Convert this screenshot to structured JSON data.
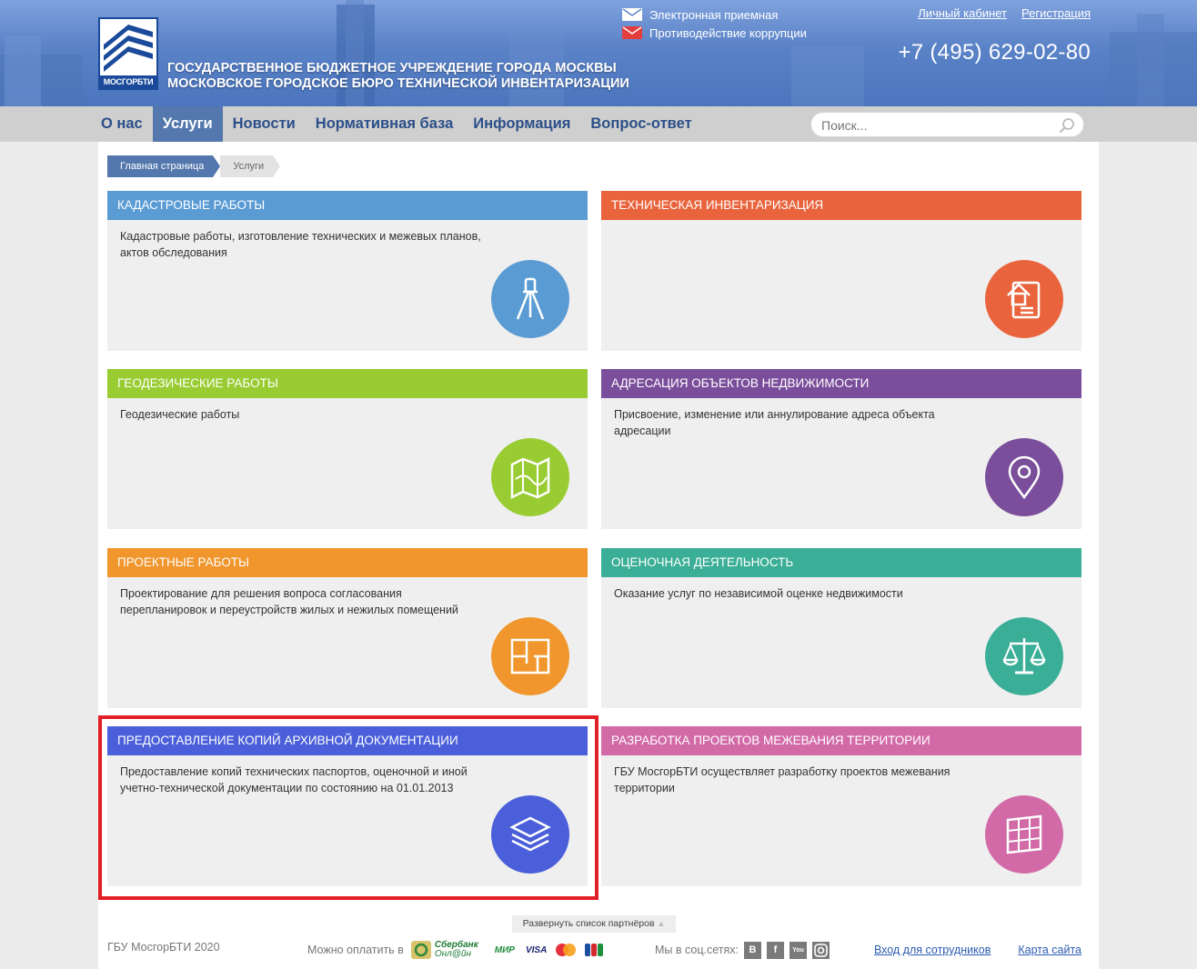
{
  "header": {
    "logo_text": "МОСГОРБТИ",
    "org_line1": "ГОСУДАРСТВЕННОЕ БЮДЖЕТНОЕ УЧРЕЖДЕНИЕ ГОРОДА МОСКВЫ",
    "org_line2": "МОСКОВСКОЕ ГОРОДСКОЕ БЮРО ТЕХНИЧЕСКОЙ ИНВЕНТАРИЗАЦИИ",
    "reception_link": "Электронная приемная",
    "anticorruption_link": "Противодействие коррупции",
    "account_link": "Личный кабинет",
    "register_link": "Регистрация",
    "phone": "+7 (495) 629-02-80"
  },
  "nav": {
    "items": [
      {
        "label": "О нас"
      },
      {
        "label": "Услуги",
        "active": true
      },
      {
        "label": "Новости"
      },
      {
        "label": "Нормативная база"
      },
      {
        "label": "Информация"
      },
      {
        "label": "Вопрос-ответ"
      }
    ],
    "search_placeholder": "Поиск..."
  },
  "breadcrumbs": {
    "home": "Главная страница",
    "current": "Услуги"
  },
  "cards": [
    {
      "title": "КАДАСТРОВЫЕ РАБОТЫ",
      "desc": "Кадастровые работы, изготовление технических и межевых планов, актов обследования",
      "color": "#5a9bd4",
      "icon": "tripod-icon"
    },
    {
      "title": "ТЕХНИЧЕСКАЯ ИНВЕНТАРИЗАЦИЯ",
      "desc": "",
      "color": "#e9643c",
      "icon": "house-document-icon"
    },
    {
      "title": "ГЕОДЕЗИЧЕСКИЕ РАБОТЫ",
      "desc": "Геодезические работы",
      "color": "#99cc33",
      "icon": "map-icon"
    },
    {
      "title": "АДРЕСАЦИЯ ОБЪЕКТОВ НЕДВИЖИМОСТИ",
      "desc": "Присвоение, изменение или аннулирование адреса объекта адресации",
      "color": "#7b4e9b",
      "icon": "location-pin-icon"
    },
    {
      "title": "ПРОЕКТНЫЕ РАБОТЫ",
      "desc": "Проектирование для решения вопроса согласования перепланировок и переустройств жилых и нежилых помещений",
      "color": "#f0962c",
      "icon": "floor-plan-icon"
    },
    {
      "title": "ОЦЕНОЧНАЯ ДЕЯТЕЛЬНОСТЬ",
      "desc": "Оказание услуг по независимой оценке недвижимости",
      "color": "#3aae96",
      "icon": "scales-icon"
    },
    {
      "title": "ПРЕДОСТАВЛЕНИЕ КОПИЙ АРХИВНОЙ ДОКУМЕНТАЦИИ",
      "desc": "Предоставление копий технических паспортов, оценочной и иной учетно-технической документации по состоянию на 01.01.2013",
      "color": "#4a5fd9",
      "icon": "layers-icon"
    },
    {
      "title": "РАЗРАБОТКА ПРОЕКТОВ МЕЖЕВАНИЯ ТЕРРИТОРИИ",
      "desc": "ГБУ МосгорБТИ осуществляет разработку проектов межевания территории",
      "color": "#d26aa8",
      "icon": "grid-map-icon"
    }
  ],
  "partners_toggle": "Развернуть список партнёров",
  "footer": {
    "copyright": "ГБУ МосгорБТИ 2020",
    "pay_label": "Можно оплатить в",
    "sber_line1": "Сбербанк",
    "sber_line2": "Онл@йн",
    "pay_mir": "МИР",
    "pay_visa": "VISA",
    "social_label": "Мы в соц.сетях:",
    "social": [
      "В",
      "f",
      "You",
      "ig"
    ],
    "staff_link": "Вход для сотрудников",
    "sitemap_link": "Карта сайта"
  }
}
